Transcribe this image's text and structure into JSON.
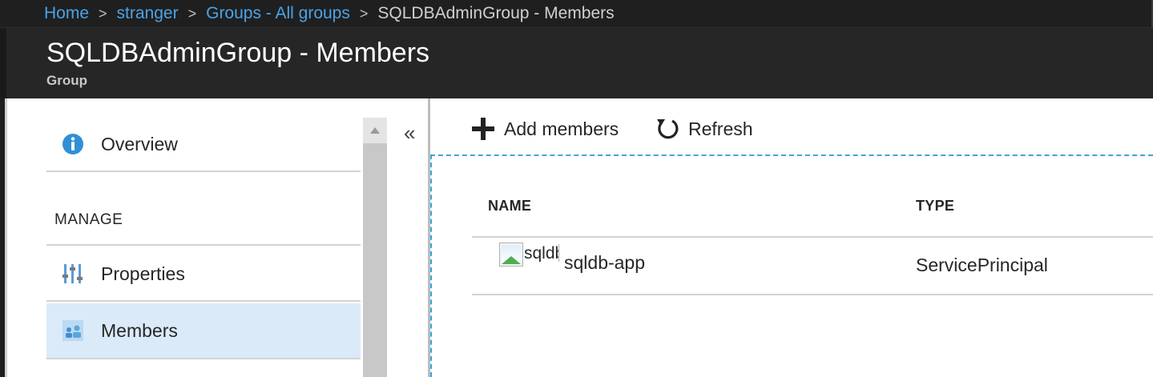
{
  "breadcrumb": {
    "items": [
      "Home",
      "stranger",
      "Groups - All groups"
    ],
    "current": "SQLDBAdminGroup - Members",
    "separator": ">"
  },
  "header": {
    "title": "SQLDBAdminGroup - Members",
    "subtitle": "Group"
  },
  "sidebar": {
    "collapse_glyph": "«",
    "overview_label": "Overview",
    "section_label": "MANAGE",
    "items": [
      {
        "label": "Properties",
        "icon": "properties-icon"
      },
      {
        "label": "Members",
        "icon": "members-icon",
        "selected": true
      }
    ]
  },
  "toolbar": {
    "add_label": "Add members",
    "refresh_label": "Refresh"
  },
  "table": {
    "columns": [
      "NAME",
      "TYPE"
    ],
    "rows": [
      {
        "image_alt": "sqldb-app",
        "name": "sqldb-app",
        "type": "ServicePrincipal"
      }
    ]
  },
  "colors": {
    "link": "#4aa3e8",
    "header_bg": "#262626",
    "selected_bg": "#dbeaf9",
    "info_blue": "#2f8fd8",
    "focus_border": "#39a6d8"
  }
}
